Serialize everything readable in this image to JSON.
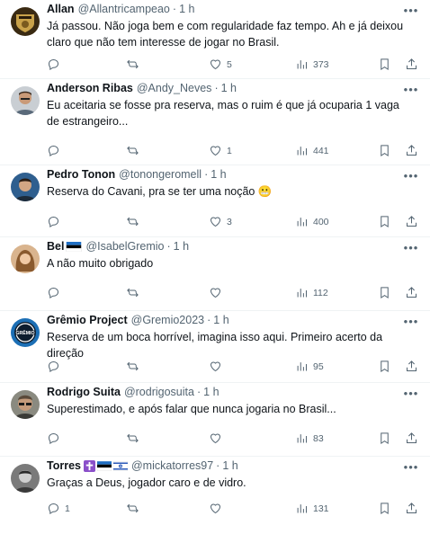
{
  "tweets": [
    {
      "name": "Allan",
      "handle": "@Allantricampeao",
      "time": "1 h",
      "text": "Já passou. Não joga bem e com regularidade faz tempo. Ah e já deixou claro que não tem interesse de jogar no Brasil.",
      "replies": "",
      "retweets": "",
      "likes": "5",
      "views": "373"
    },
    {
      "name": "Anderson Ribas",
      "handle": "@Andy_Neves",
      "time": "1 h",
      "text": "Eu aceitaria se fosse pra reserva, mas o ruim é que já ocuparia 1 vaga de estrangeiro...",
      "replies": "",
      "retweets": "",
      "likes": "1",
      "views": "441"
    },
    {
      "name": "Pedro Tonon",
      "handle": "@tonongeromell",
      "time": "1 h",
      "text": "Reserva do Cavani, pra se ter uma noção 😬",
      "replies": "",
      "retweets": "",
      "likes": "3",
      "views": "400"
    },
    {
      "name": "Bel",
      "handle": "@IsabelGremio",
      "time": "1 h",
      "text": "A não muito obrigado",
      "replies": "",
      "retweets": "",
      "likes": "",
      "views": "112"
    },
    {
      "name": "Grêmio Project",
      "handle": "@Gremio2023",
      "time": "1 h",
      "text": "Reserva de um boca horrível, imagina isso aqui. Primeiro acerto da direção",
      "replies": "",
      "retweets": "",
      "likes": "",
      "views": "95"
    },
    {
      "name": "Rodrigo Suita",
      "handle": "@rodrigosuita",
      "time": "1 h",
      "text": "Superestimado, e após falar que nunca jogaria no Brasil...",
      "replies": "",
      "retweets": "",
      "likes": "",
      "views": "83"
    },
    {
      "name": "Torres",
      "handle": "@mickatorres97",
      "time": "1 h",
      "text": "Graças a Deus, jogador caro e de vidro.",
      "replies": "1",
      "retweets": "",
      "likes": "",
      "views": "131"
    }
  ],
  "avatar_logo_text": "GRÊMIO",
  "colors": {
    "text": "#0f1419",
    "muted": "#536471",
    "divider": "#eff3f4",
    "gremio_blue": "#1c6fb5"
  }
}
